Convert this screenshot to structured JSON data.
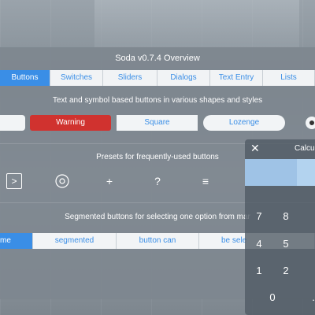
{
  "window": {
    "title": "Soda v0.7.4 Overview"
  },
  "tabs": [
    {
      "label": "Buttons",
      "active": true
    },
    {
      "label": "Switches",
      "active": false
    },
    {
      "label": "Sliders",
      "active": false
    },
    {
      "label": "Dialogs",
      "active": false
    },
    {
      "label": "Text Entry",
      "active": false
    },
    {
      "label": "Lists",
      "active": false
    }
  ],
  "buttons_section": {
    "caption": "Text and symbol based buttons in various shapes and styles",
    "warning_label": "Warning",
    "square_label": "Square",
    "lozenge_label": "Lozenge"
  },
  "presets_section": {
    "caption": "Presets for frequently-used buttons",
    "symbols": [
      ">",
      "⊙",
      "+",
      "?",
      "≡"
    ]
  },
  "segmented_section": {
    "caption": "Segmented buttons for selecting one option from mar",
    "items": [
      "me",
      "segmented",
      "button can",
      "be sele"
    ]
  },
  "calculator": {
    "title": "Calcu",
    "close_symbol": "✕",
    "keys": [
      "7",
      "8",
      "4",
      "5",
      "1",
      "2",
      "0",
      "."
    ]
  },
  "colors": {
    "accent": "#3a8ee6",
    "warning": "#d0322f",
    "calc_display": "#9fc3e6"
  }
}
